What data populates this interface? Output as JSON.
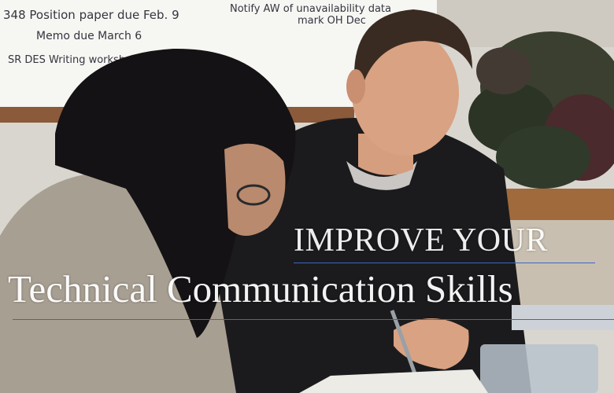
{
  "banner": {
    "headline_top": "IMPROVE YOUR",
    "headline_main": "Technical Communication Skills"
  },
  "whiteboard": {
    "lines": [
      "348  Position paper due Feb. 9",
      "Memo due March 6",
      "SR DES   Writing workshops  A = 1/",
      "Notify AW of   unavailability data",
      "mark  OH  Dec"
    ]
  },
  "colors": {
    "rule": "#3a66c6",
    "headline": "#ffffff"
  }
}
